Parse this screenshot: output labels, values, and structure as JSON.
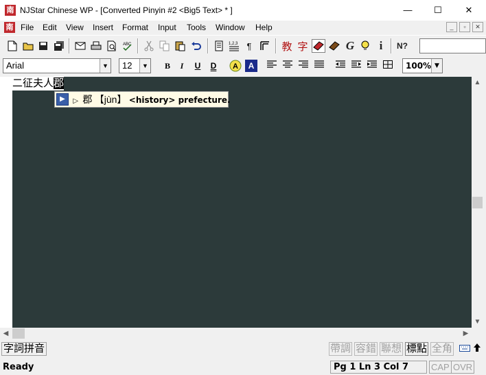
{
  "window": {
    "title": "NJStar Chinese WP - [Converted Pinyin #2 <Big5 Text> * ]",
    "app_icon": "南",
    "minimize": "—",
    "maximize": "☐",
    "close": "✕"
  },
  "menu": {
    "doc_icon": "南",
    "items": [
      "File",
      "Edit",
      "View",
      "Insert",
      "Format",
      "Input",
      "Tools",
      "Window",
      "Help"
    ],
    "mdi": [
      "_",
      "▫",
      "✕"
    ]
  },
  "toolbar": {
    "cn_jiao": "教",
    "cn_zi": "字",
    "g_label": "G",
    "info_label": "i",
    "help_label": "N?"
  },
  "format_bar": {
    "font": "Arial",
    "size": "12",
    "bold": "B",
    "italic": "I",
    "underline": "U",
    "double_underline": "D",
    "highlight": "A",
    "zoom": "100%"
  },
  "document": {
    "text_plain": "二征夫人",
    "text_selected": "郡"
  },
  "tooltip": {
    "icon": "▶",
    "play": "▷",
    "hanzi": "郡",
    "pinyin": "【jùn】",
    "definition": "<history> prefecture."
  },
  "ime_bar": {
    "mode": "字詞拼音",
    "options": [
      {
        "label": "帶調",
        "on": false
      },
      {
        "label": "容錯",
        "on": false
      },
      {
        "label": "聯想",
        "on": false
      },
      {
        "label": "標點",
        "on": true
      },
      {
        "label": "全角",
        "on": false
      }
    ]
  },
  "status": {
    "ready": "Ready",
    "position": "Pg 1   Ln 3  Col 7",
    "cap": "CAP",
    "ovr": "OVR"
  }
}
